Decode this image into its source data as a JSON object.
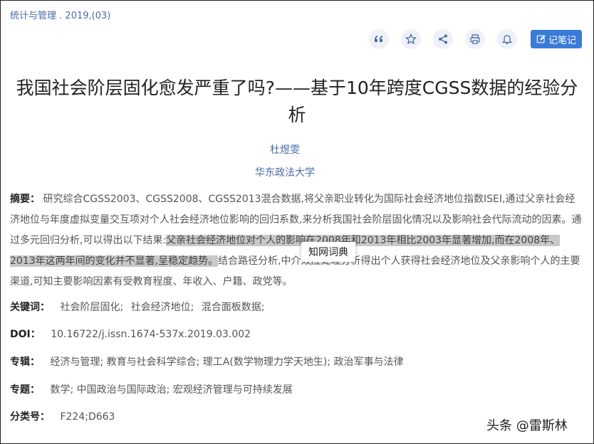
{
  "source": {
    "journal": "统计与管理",
    "issue": ". 2019,(03)"
  },
  "toolbar": {
    "buttons": [
      "quote-icon",
      "star-icon",
      "share-icon",
      "print-icon",
      "bell-icon"
    ],
    "note_label": "记笔记"
  },
  "article": {
    "title": "我国社会阶层固化愈发严重了吗?——基于10年跨度CGSS数据的经验分析",
    "author": "杜煜雯",
    "organization": "华东政法大学",
    "abstract_label": "摘要：",
    "abstract_pre": "研究综合CGSS2003、CGSS2008、CGSS2013混合数据,将父亲职业转化为国际社会经济地位指数ISEI,通过父亲社会经济地位与年度虚拟变量交互项对个人社会经济地位影响的回归系数,来分析我国社会阶层固化情况以及影响社会代际流动的因素。通过多元回归分析,可以得出以下结果:",
    "abstract_highlight": "父亲社会经济地位对个人的影响在2008年和2013年相比2003年显著增加,而在2008年、2013年这两年间的变化并不显著,呈稳定趋势。",
    "abstract_post": "结合路径分析,中介效应处理分析得出个人获得社会经济地位及父亲影响个人的主要渠道,可知主要影响因素有受教育程度、年收入、户籍、政党等。",
    "tooltip": "知网词典",
    "keywords_label": "关键词：",
    "keywords": [
      "社会阶层固化;",
      "社会经济地位;",
      "混合面板数据;"
    ],
    "doi_label": "DOI：",
    "doi": "10.16722/j.issn.1674-537x.2019.03.002",
    "series_label": "专辑：",
    "series": "经济与管理; 教育与社会科学综合; 理工A(数学物理力学天地生); 政治军事与法律",
    "topic_label": "专题：",
    "topic": "数学; 中国政治与国际政治; 宏观经济管理与可持续发展",
    "class_label": "分类号：",
    "class_no": "F224;D663"
  },
  "watermark": "头条 @雷斯林"
}
